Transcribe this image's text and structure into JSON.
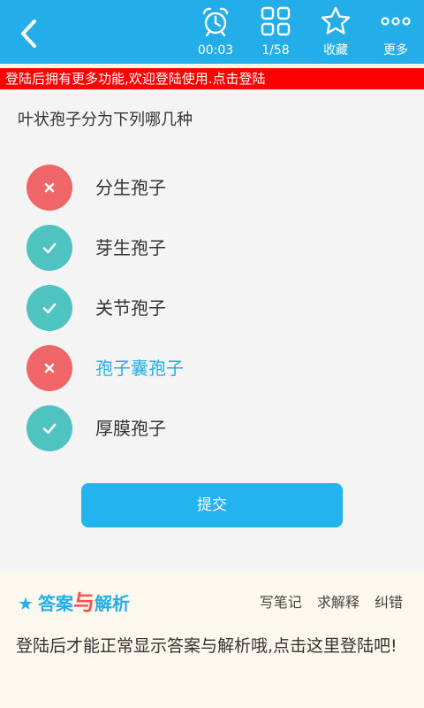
{
  "colors": {
    "header_bg": "#23aee9",
    "banner_bg": "#ff0000",
    "wrong": "#f06567",
    "right": "#4fc3c0",
    "accent": "#23aee9",
    "submit": "#23b3ef",
    "answer_panel_bg": "#fdf8ee"
  },
  "header": {
    "back_icon": "chevron-left-icon",
    "tools": [
      {
        "icon": "alarm-clock-icon",
        "label": "00:03"
      },
      {
        "icon": "grid-icon",
        "label": "1/58"
      },
      {
        "icon": "star-icon",
        "label": "收藏"
      },
      {
        "icon": "more-dots-icon",
        "label": "更多"
      }
    ]
  },
  "login_banner": "登陆后拥有更多功能,欢迎登陆使用.点击登陆",
  "question": "叶状孢子分为下列哪几种",
  "options": [
    {
      "label": "分生孢子",
      "state": "wrong",
      "selected": false
    },
    {
      "label": "芽生孢子",
      "state": "right",
      "selected": false
    },
    {
      "label": "关节孢子",
      "state": "right",
      "selected": false
    },
    {
      "label": "孢子囊孢子",
      "state": "wrong",
      "selected": true
    },
    {
      "label": "厚膜孢子",
      "state": "right",
      "selected": false
    }
  ],
  "submit_label": "提交",
  "answer_panel": {
    "title_part1": "答案",
    "title_part2": "与",
    "title_part3": "解析",
    "actions": [
      "写笔记",
      "求解释",
      "纠错"
    ],
    "message": "登陆后才能正常显示答案与解析哦,点击这里登陆吧!"
  }
}
